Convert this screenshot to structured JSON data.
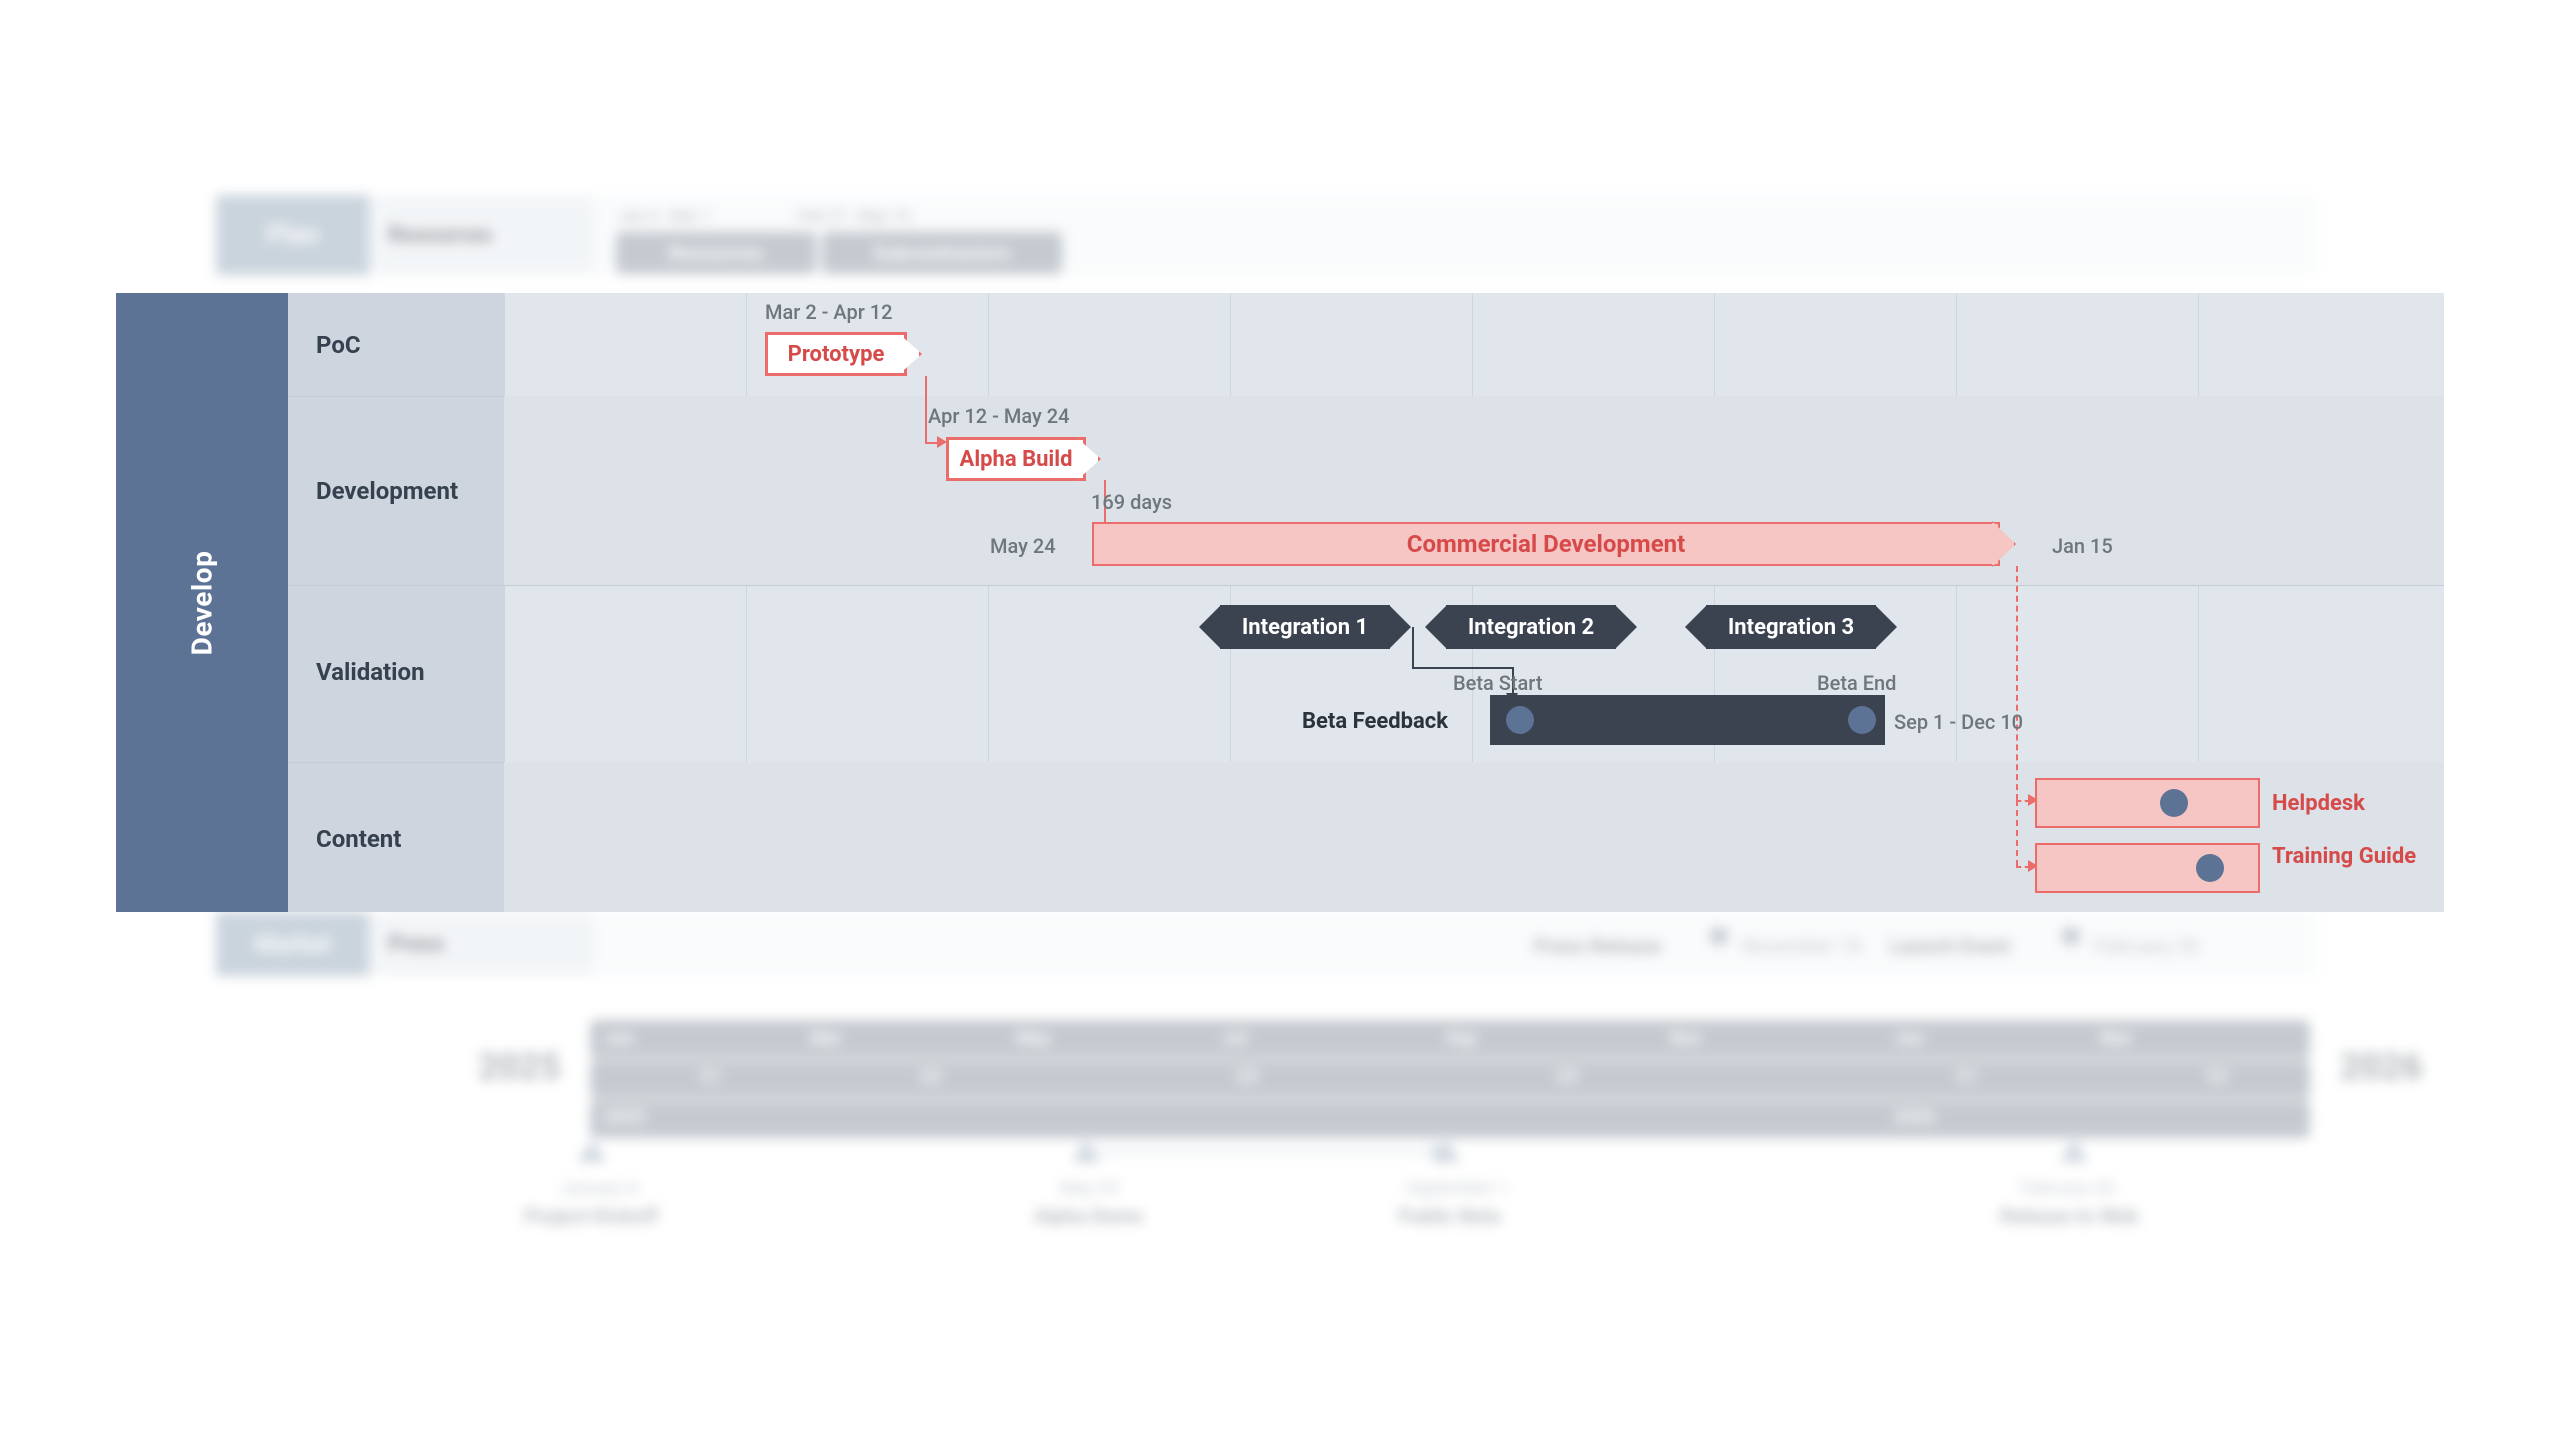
{
  "bg": {
    "plan": {
      "label": "Plan",
      "row": "Resources",
      "chipsDates": [
        "Jan 6 - Mar 1",
        "Feb 27 - May 16"
      ],
      "chips": [
        "Resources",
        "Subcontractors"
      ]
    },
    "market": {
      "label": "Market",
      "row": "Press",
      "press_release": "Press Release",
      "press_date": "November 18",
      "launch_event": "Launch Event",
      "launch_date": "February 26"
    },
    "timeline": {
      "left_year": "2025",
      "right_year": "2026",
      "months": [
        "Jan",
        "Mar",
        "May",
        "Jul",
        "Sep",
        "Nov",
        "Jan",
        "Mar"
      ],
      "quarters": [
        "Q1",
        "Q2",
        "Q3",
        "Q4",
        "Q1",
        "Q2"
      ],
      "year_band": [
        "2025",
        "2026"
      ]
    },
    "milestones": [
      {
        "name": "Project Kickoff",
        "date": "January 6"
      },
      {
        "name": "Alpha Demo",
        "date": "May 25"
      },
      {
        "name": "Public Beta",
        "date": "September 1"
      },
      {
        "name": "Release to Web",
        "date": "February 26"
      }
    ]
  },
  "develop": {
    "phase": "Develop",
    "rows": {
      "poc": "PoC",
      "dev": "Development",
      "val": "Validation",
      "content": "Content"
    },
    "prototype": {
      "label": "Prototype",
      "dates": "Mar 2 - Apr 12"
    },
    "alpha": {
      "label": "Alpha Build",
      "dates": "Apr 12 - May 24"
    },
    "commercial": {
      "label": "Commercial Development",
      "duration": "169 days",
      "start": "May 24",
      "end": "Jan 15"
    },
    "integrations": [
      "Integration 1",
      "Integration 2",
      "Integration 3"
    ],
    "beta": {
      "label": "Beta Feedback",
      "start": "Beta Start",
      "end": "Beta End",
      "range": "Sep 1 - Dec 10"
    },
    "content": {
      "helpdesk": "Helpdesk",
      "training": "Training Guide"
    }
  }
}
